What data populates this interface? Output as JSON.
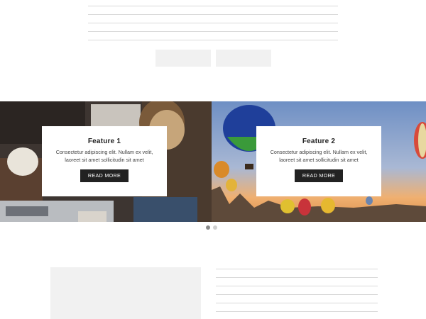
{
  "top_placeholder": {
    "line_count": 5
  },
  "placeholder_buttons": 2,
  "carousel": {
    "slides": [
      {
        "title": "Feature 1",
        "text": "Consectetur adipiscing elit. Nullam ex velit, laoreet sit amet sollicitudin sit amet",
        "button_label": "READ MORE",
        "image": "workspace-photo"
      },
      {
        "title": "Feature 2",
        "text": "Consectetur adipiscing elit. Nullam ex velit, laoreet sit amet sollicitudin sit amet",
        "button_label": "READ MORE",
        "image": "hot-air-balloons-photo"
      }
    ],
    "active_index": 0,
    "dot_count": 2
  },
  "bottom_placeholder": {
    "line_count": 6
  },
  "colors": {
    "placeholder_fill": "#f1f1f1",
    "placeholder_line": "#d9d9d9",
    "button_dark": "#222222"
  }
}
